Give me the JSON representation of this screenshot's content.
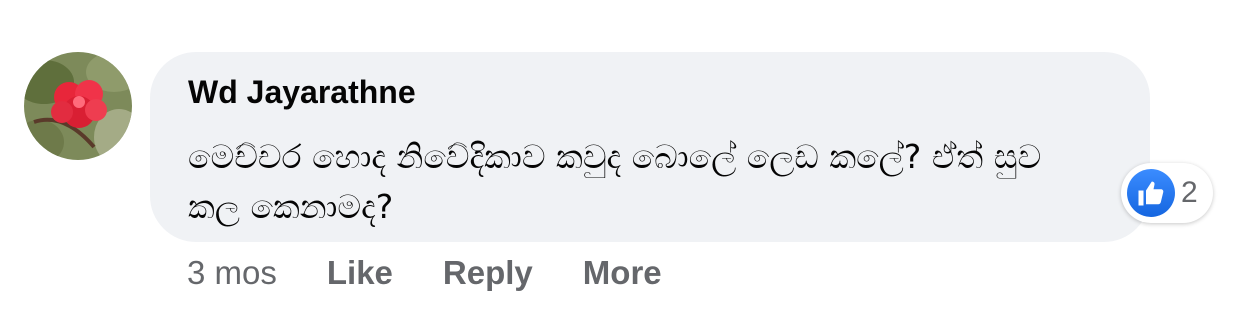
{
  "comment": {
    "author": "Wd Jayarathne",
    "text": "මෙච්චර හොද නිවේදිකාව කවුද බොලේ ලෙඩ කලේ? ඒත් සුව කල කෙනාමද?",
    "reaction_icon": "like-icon",
    "reaction_count": "2"
  },
  "actions": {
    "time": "3 mos",
    "like_label": "Like",
    "reply_label": "Reply",
    "more_label": "More"
  },
  "colors": {
    "bubble": "#f0f2f5",
    "like_blue": "#1877f2",
    "muted_text": "#65676b"
  }
}
